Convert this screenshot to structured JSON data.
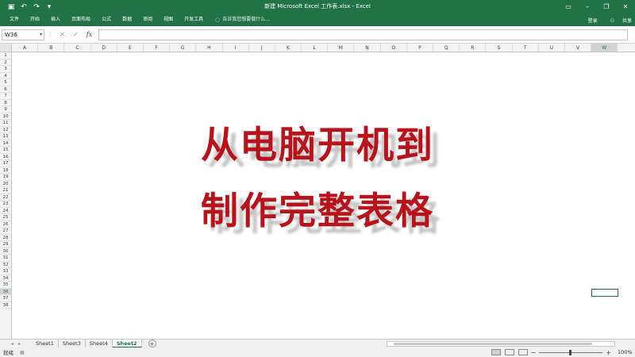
{
  "window": {
    "title": "新建 Microsoft Excel 工作表.xlsx - Excel",
    "qat_icons": [
      "save-icon",
      "undo-icon",
      "redo-icon",
      "customize-icon"
    ],
    "controls": [
      "restore-ribbon-icon",
      "minimize-icon",
      "maximize-icon",
      "close-icon"
    ]
  },
  "ribbon": {
    "tabs": [
      "文件",
      "开始",
      "插入",
      "页面布局",
      "公式",
      "数据",
      "审阅",
      "视图",
      "开发工具"
    ],
    "tell_me": "告诉我您想要做什么...",
    "signin": "登录",
    "share": "共享"
  },
  "formula_bar": {
    "name_box": "W36",
    "formula_value": ""
  },
  "grid": {
    "columns": [
      "A",
      "B",
      "C",
      "D",
      "E",
      "F",
      "G",
      "H",
      "I",
      "J",
      "K",
      "L",
      "M",
      "N",
      "O",
      "P",
      "Q",
      "R",
      "S",
      "T",
      "U",
      "V",
      "W"
    ],
    "rows": [
      "1",
      "2",
      "3",
      "4",
      "5",
      "6",
      "7",
      "8",
      "9",
      "10",
      "11",
      "12",
      "13",
      "14",
      "15",
      "16",
      "17",
      "18",
      "19",
      "20",
      "21",
      "22",
      "23",
      "24",
      "25",
      "26",
      "27",
      "28",
      "29",
      "30",
      "31",
      "32",
      "33",
      "34",
      "35",
      "36",
      "37",
      "38"
    ],
    "selected_column": "W",
    "selected_row": "36",
    "colors": {
      "header_bg": "#f3f3f3",
      "accent": "#217346"
    }
  },
  "overlay": {
    "line1": "从电脑开机到",
    "line2": "制作完整表格",
    "color": "#b8121b"
  },
  "sheets": {
    "tabs": [
      "Sheet1",
      "Sheet3",
      "Sheet4",
      "Sheet2"
    ],
    "active": "Sheet2"
  },
  "status": {
    "ready": "就绪",
    "zoom": "100%"
  }
}
